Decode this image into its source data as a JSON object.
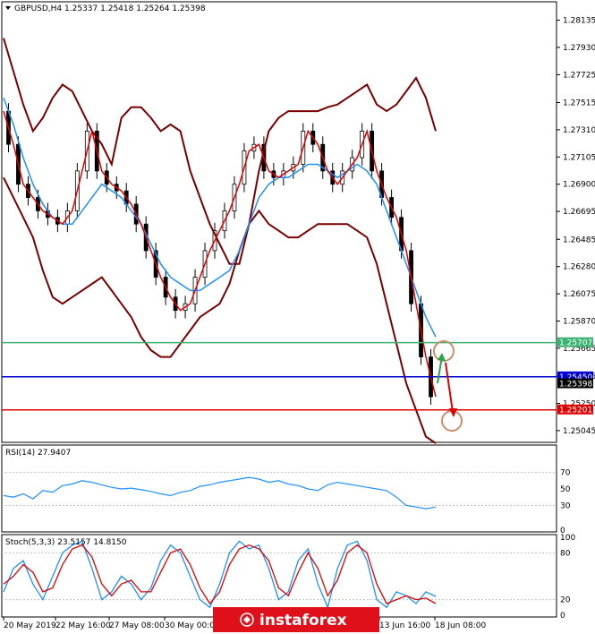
{
  "chart_data": [
    {
      "type": "line",
      "subtype": "candlestick",
      "header": {
        "symbol": "GBPUSD,H4",
        "open": "1.25337",
        "high": "1.25418",
        "low": "1.25264",
        "close": "1.25398"
      },
      "y_ticks": [
        "1.28135",
        "1.27930",
        "1.27725",
        "1.27515",
        "1.27310",
        "1.27105",
        "1.26900",
        "1.26695",
        "1.26485",
        "1.26280",
        "1.26075",
        "1.25870",
        "1.25665",
        "1.25455",
        "1.25250",
        "1.25045"
      ],
      "ylim": [
        1.2497,
        1.2826
      ],
      "x_tick_labels": [
        "20 May 2019",
        "22 May 16:00",
        "27 May 08:00",
        "30 May 00:00",
        "13 Jun 16:00",
        "18 Jun 08:00"
      ],
      "level_lines": [
        {
          "price": 1.25707,
          "label": "1.25707",
          "color": "#3cb371"
        },
        {
          "price": 1.2545,
          "label": "1.25450",
          "color": "#0000cd"
        },
        {
          "price": 1.25398,
          "label": "1.25398",
          "color": "#000000"
        },
        {
          "price": 1.25201,
          "label": "1.25201",
          "color": "#e00000"
        }
      ],
      "candles": [],
      "bollinger": {
        "upper": [
          1.28,
          1.2775,
          1.275,
          1.273,
          1.274,
          1.2755,
          1.2765,
          1.276,
          1.2745,
          1.273,
          1.272,
          1.2705,
          1.274,
          1.2748,
          1.2748,
          1.274,
          1.273,
          1.2735,
          1.273,
          1.27,
          1.268,
          1.266,
          1.2645,
          1.263,
          1.263,
          1.266,
          1.27,
          1.273,
          1.274,
          1.2745,
          1.2745,
          1.2745,
          1.2745,
          1.2748,
          1.275,
          1.2755,
          1.276,
          1.2765,
          1.275,
          1.2745,
          1.275,
          1.276,
          1.277,
          1.2755,
          1.273
        ],
        "middle": [
          1.2755,
          1.2735,
          1.271,
          1.269,
          1.2675,
          1.2665,
          1.266,
          1.266,
          1.267,
          1.268,
          1.269,
          1.2685,
          1.268,
          1.267,
          1.266,
          1.2645,
          1.263,
          1.262,
          1.2615,
          1.261,
          1.261,
          1.2615,
          1.262,
          1.2625,
          1.264,
          1.266,
          1.268,
          1.269,
          1.2695,
          1.2695,
          1.27,
          1.2705,
          1.2705,
          1.27,
          1.2695,
          1.27,
          1.2705,
          1.27,
          1.269,
          1.267,
          1.265,
          1.263,
          1.261,
          1.259,
          1.2575
        ],
        "lower": [
          1.2695,
          1.268,
          1.2665,
          1.265,
          1.2625,
          1.2605,
          1.26,
          1.2605,
          1.261,
          1.2615,
          1.262,
          1.261,
          1.26,
          1.259,
          1.2575,
          1.2565,
          1.256,
          1.256,
          1.257,
          1.258,
          1.259,
          1.2595,
          1.26,
          1.2615,
          1.264,
          1.266,
          1.267,
          1.266,
          1.2655,
          1.265,
          1.265,
          1.2655,
          1.266,
          1.266,
          1.266,
          1.266,
          1.2655,
          1.265,
          1.263,
          1.26,
          1.257,
          1.254,
          1.252,
          1.25,
          1.2495
        ]
      },
      "fast_ma": [
        1.2745,
        1.272,
        1.269,
        1.268,
        1.267,
        1.2665,
        1.266,
        1.267,
        1.27,
        1.273,
        1.27,
        1.269,
        1.2685,
        1.2675,
        1.266,
        1.264,
        1.262,
        1.2605,
        1.2595,
        1.26,
        1.262,
        1.264,
        1.2655,
        1.267,
        1.269,
        1.2715,
        1.272,
        1.27,
        1.2695,
        1.27,
        1.2705,
        1.273,
        1.272,
        1.27,
        1.269,
        1.27,
        1.271,
        1.273,
        1.27,
        1.268,
        1.2665,
        1.264,
        1.26,
        1.256,
        1.253
      ]
    },
    {
      "type": "line",
      "title": "RSI(14) 27.9407",
      "y_ticks": [
        "70",
        "50",
        "30",
        "0"
      ],
      "ylim": [
        0,
        100
      ],
      "values": [
        42,
        40,
        44,
        38,
        48,
        46,
        54,
        56,
        60,
        58,
        55,
        52,
        50,
        51,
        49,
        47,
        44,
        42,
        46,
        48,
        53,
        55,
        58,
        60,
        62,
        64,
        62,
        58,
        60,
        56,
        54,
        50,
        48,
        55,
        58,
        56,
        54,
        52,
        50,
        48,
        40,
        30,
        28,
        26,
        28
      ]
    },
    {
      "type": "line",
      "title": "Stoch(5,3,3) 23.5157 14.8150",
      "y_ticks": [
        "100",
        "80",
        "20",
        "0"
      ],
      "ylim": [
        0,
        100
      ],
      "series": [
        {
          "values": [
            30,
            60,
            70,
            40,
            20,
            50,
            80,
            90,
            95,
            60,
            20,
            30,
            50,
            40,
            20,
            35,
            70,
            90,
            80,
            50,
            20,
            10,
            40,
            80,
            95,
            85,
            90,
            60,
            20,
            30,
            70,
            85,
            40,
            10,
            60,
            90,
            95,
            70,
            20,
            10,
            30,
            25,
            15,
            30,
            24
          ]
        },
        {
          "values": [
            40,
            50,
            65,
            55,
            30,
            35,
            65,
            85,
            90,
            75,
            40,
            25,
            40,
            45,
            30,
            30,
            55,
            80,
            85,
            65,
            35,
            15,
            30,
            65,
            85,
            90,
            85,
            70,
            35,
            25,
            55,
            80,
            60,
            25,
            45,
            80,
            90,
            80,
            40,
            15,
            20,
            25,
            20,
            22,
            15
          ]
        }
      ]
    }
  ],
  "watermark": "instaforex",
  "icons": {
    "dropdown": "triangle-down-icon"
  }
}
